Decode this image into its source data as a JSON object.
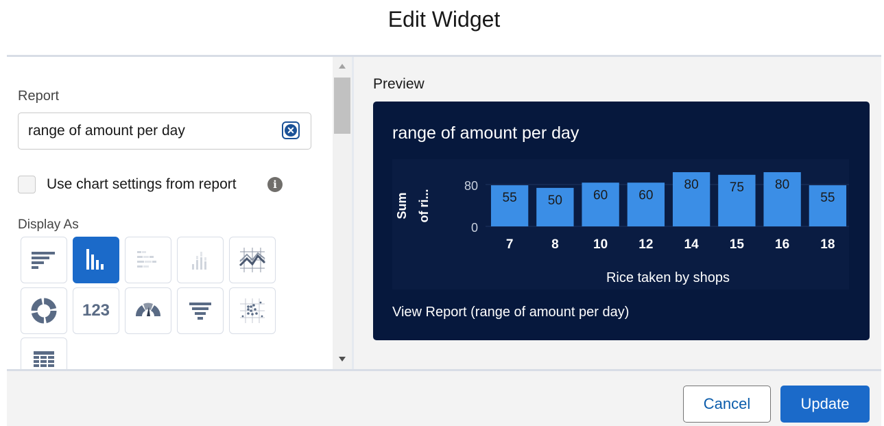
{
  "dialog": {
    "title": "Edit Widget"
  },
  "form": {
    "report_label": "Report",
    "report_value": "range of amount per day",
    "use_chart_settings_label": "Use chart settings from report",
    "use_chart_settings_checked": false,
    "display_as_label": "Display As",
    "display_types": [
      {
        "icon": "horizontal-bar-chart-icon",
        "selected": false
      },
      {
        "icon": "vertical-bar-chart-icon",
        "selected": true
      },
      {
        "icon": "stacked-horizontal-bar-chart-icon",
        "selected": false
      },
      {
        "icon": "stacked-vertical-bar-chart-icon",
        "selected": false
      },
      {
        "icon": "line-chart-icon",
        "selected": false
      },
      {
        "icon": "donut-chart-icon",
        "selected": false
      },
      {
        "icon": "metric-icon",
        "selected": false,
        "text": "123"
      },
      {
        "icon": "gauge-icon",
        "selected": false
      },
      {
        "icon": "funnel-chart-icon",
        "selected": false
      },
      {
        "icon": "scatter-chart-icon",
        "selected": false
      },
      {
        "icon": "table-icon",
        "selected": false
      }
    ]
  },
  "preview": {
    "label": "Preview",
    "view_report_link": "View Report (range of amount per day)"
  },
  "chart_data": {
    "type": "bar",
    "title": "range of amount per day",
    "categories": [
      "7",
      "8",
      "10",
      "12",
      "14",
      "15",
      "16",
      "18"
    ],
    "values": [
      55,
      50,
      60,
      60,
      80,
      75,
      80,
      55
    ],
    "xlabel": "Rice taken by shops",
    "ylabel": "Sum of ri...",
    "ylim": [
      0,
      80
    ],
    "yticks": [
      "80",
      "0"
    ],
    "colors": {
      "bar": "#3b8ee6",
      "background": "#06183d",
      "text": "#ffffff"
    }
  },
  "footer": {
    "cancel_label": "Cancel",
    "update_label": "Update"
  }
}
